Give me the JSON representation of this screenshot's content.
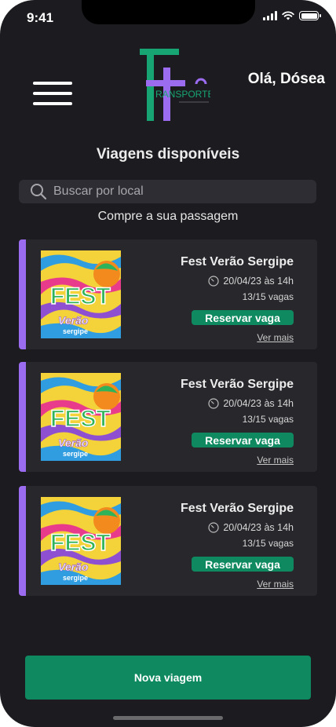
{
  "status_bar": {
    "time": "9:41"
  },
  "header": {
    "greeting": "Olá, Dósea",
    "logo_text": "RANSPORTE",
    "logo_letters": "TT"
  },
  "main": {
    "title": "Viagens disponíveis",
    "search": {
      "placeholder": "Buscar por local",
      "value": ""
    },
    "subtitle": "Compre a sua passagem"
  },
  "trips": [
    {
      "title": "Fest Verão Sergipe",
      "date": "20/04/23 às 14h",
      "seats": "13/15 vagas",
      "reserve_label": "Reservar vaga",
      "more_label": "Ver mais",
      "poster_text": "FEST",
      "poster_sub": "Verão",
      "poster_sub2": "sergipe"
    },
    {
      "title": "Fest Verão Sergipe",
      "date": "20/04/23 às 14h",
      "seats": "13/15 vagas",
      "reserve_label": "Reservar vaga",
      "more_label": "Ver mais",
      "poster_text": "FEST",
      "poster_sub": "Verão",
      "poster_sub2": "sergipe"
    },
    {
      "title": "Fest Verão Sergipe",
      "date": "20/04/23 às 14h",
      "seats": "13/15 vagas",
      "reserve_label": "Reservar vaga",
      "more_label": "Ver mais",
      "poster_text": "FEST",
      "poster_sub": "Verão",
      "poster_sub2": "sergipe"
    }
  ],
  "footer": {
    "new_trip_label": "Nova viagem"
  },
  "colors": {
    "background": "#1c1b1f",
    "card": "#28272c",
    "accent_purple": "#9b6cf0",
    "primary_green": "#0f8a60",
    "logo_green": "#17a673"
  },
  "icons": [
    "menu-icon",
    "search-icon",
    "clock-icon",
    "signal-icon",
    "wifi-icon",
    "battery-icon"
  ]
}
